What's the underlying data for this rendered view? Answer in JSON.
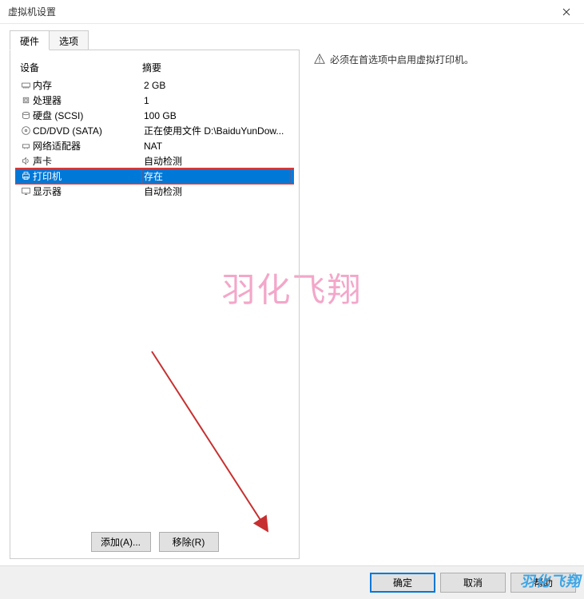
{
  "window": {
    "title": "虚拟机设置"
  },
  "tabs": {
    "hardware": "硬件",
    "options": "选项"
  },
  "columns": {
    "device": "设备",
    "summary": "摘要"
  },
  "devices": [
    {
      "icon": "memory",
      "name": "内存",
      "summary": "2 GB",
      "selected": false
    },
    {
      "icon": "cpu",
      "name": "处理器",
      "summary": "1",
      "selected": false
    },
    {
      "icon": "disk",
      "name": "硬盘 (SCSI)",
      "summary": "100 GB",
      "selected": false
    },
    {
      "icon": "cd",
      "name": "CD/DVD (SATA)",
      "summary": "正在使用文件 D:\\BaiduYunDow...",
      "selected": false
    },
    {
      "icon": "network",
      "name": "网络适配器",
      "summary": "NAT",
      "selected": false
    },
    {
      "icon": "sound",
      "name": "声卡",
      "summary": "自动检测",
      "selected": false
    },
    {
      "icon": "printer",
      "name": "打印机",
      "summary": "存在",
      "selected": true
    },
    {
      "icon": "display",
      "name": "显示器",
      "summary": "自动检测",
      "selected": false
    }
  ],
  "buttons": {
    "add": "添加(A)...",
    "remove": "移除(R)",
    "ok": "确定",
    "cancel": "取消",
    "help": "帮助"
  },
  "warning": {
    "text": "必须在首选项中启用虚拟打印机。"
  },
  "watermark": {
    "center": "羽化飞翔",
    "corner": "羽化飞翔"
  }
}
